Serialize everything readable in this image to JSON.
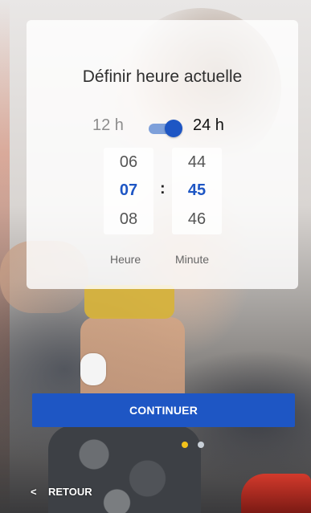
{
  "card": {
    "title": "Définir heure actuelle",
    "format_12_label": "12 h",
    "format_24_label": "24 h",
    "format_24_enabled": true
  },
  "hour_picker": {
    "prev": "06",
    "selected": "07",
    "next": "08",
    "label": "Heure"
  },
  "separator": ":",
  "minute_picker": {
    "prev": "44",
    "selected": "45",
    "next": "46",
    "label": "Minute"
  },
  "continue_label": "CONTINUER",
  "pagination": {
    "total": 2,
    "current": 1,
    "active_color": "#F3C21B",
    "inactive_color": "#C9D0D8"
  },
  "back": {
    "icon": "chevron-left-icon",
    "label": "RETOUR"
  },
  "colors": {
    "accent": "#1E56C4"
  }
}
